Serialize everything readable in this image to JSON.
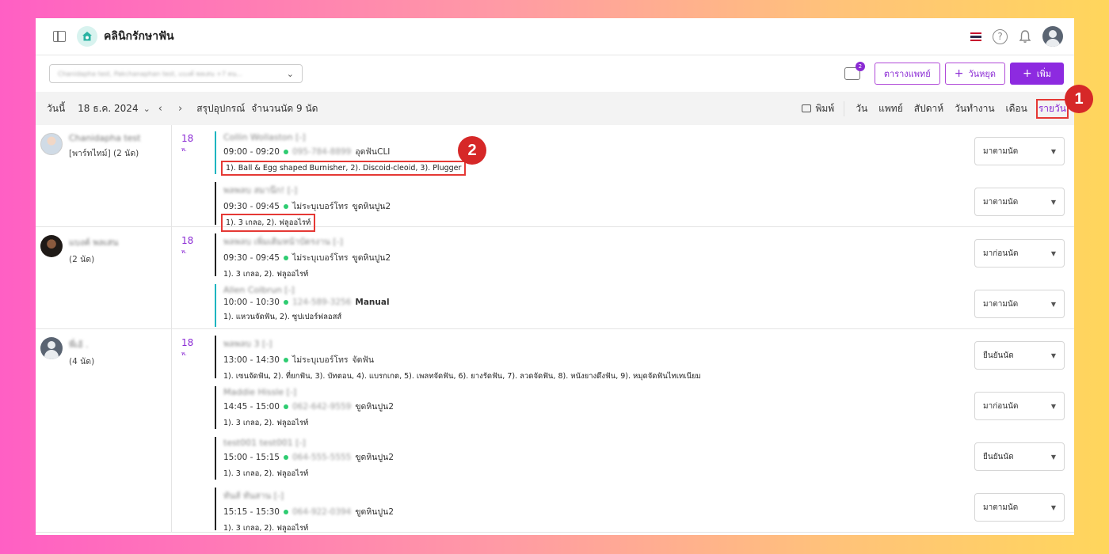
{
  "app": {
    "brand": "คลินิกรักษาฟัน"
  },
  "filter": {
    "doctor_select_value": "Chanidapha test, Pakchanaphan test, แบงค์ พลเสน +7 คน...",
    "inbox_badge": "2",
    "btn_schedule": "ตารางแพทย์",
    "btn_holiday": "วันหยุด",
    "btn_add": "เพิ่ม"
  },
  "datebar": {
    "today": "วันนี้",
    "date": "18 ธ.ค. 2024",
    "prev": "‹",
    "next": "›",
    "summary_equipment": "สรุปอุปกรณ์",
    "summary_count": "จำนวนนัด 9 นัด",
    "print": "พิมพ์",
    "tabs": [
      "วัน",
      "แพทย์",
      "สัปดาห์",
      "วันทำงาน",
      "เดือน",
      "รายวัน"
    ]
  },
  "steps": [
    "1",
    "2"
  ],
  "groups": [
    {
      "doctor_name": "Chanidapha test",
      "doctor_sub": "[พาร์ทไทม์] (2 นัด)",
      "day": "18",
      "day_sub": "พ.",
      "appointments": [
        {
          "patient": "Collin Wollaston [-]",
          "time": "09:00 - 09:20",
          "phone": "095-784-8899",
          "note": "อุดฟันCLI",
          "items": "1). Ball & Egg shaped Burnisher, 2). Discoid-cleoid, 3). Plugger",
          "status": "มาตามนัด",
          "bar": "teal"
        },
        {
          "patient": "พลพลบ สมาน๊ก! [-]",
          "time": "09:30 - 09:45",
          "phone": "ไม่ระบุเบอร์โทร",
          "note": "ขูดหินปูน2",
          "items": "1). 3 เกลอ, 2). ฟลูออไรท์",
          "status": "มาตามนัด",
          "bar": "dark"
        }
      ]
    },
    {
      "doctor_name": "แบงค์ พลเสน",
      "doctor_sub": "(2 นัด)",
      "day": "18",
      "day_sub": "พ.",
      "appointments": [
        {
          "patient": "พลพลบ เพิ่มเติมหน้าบัตรงาน [-]",
          "time": "09:30 - 09:45",
          "phone": "ไม่ระบุเบอร์โทร",
          "note": "ขูดหินปูน2",
          "items": "1). 3 เกลอ, 2). ฟลูออไรท์",
          "status": "มาก่อนนัด",
          "bar": "dark"
        },
        {
          "patient": "Allen Colbrun [-]",
          "time": "10:00 - 10:30",
          "phone": "124-589-3256",
          "note": "Manual",
          "items": "1). แหวนจัดฟัน, 2). ซูปเปอร์ฟลอสส์",
          "status": "มาตามนัด",
          "bar": "teal"
        }
      ]
    },
    {
      "doctor_name": "พี่เอ้ .",
      "doctor_sub": "(4 นัด)",
      "day": "18",
      "day_sub": "พ.",
      "appointments": [
        {
          "patient": "พลพลบ 3 [-]",
          "time": "13:00 - 14:30",
          "phone": "ไม่ระบุเบอร์โทร",
          "note": "จัดฟัน",
          "items": "1). เซนจัดฟัน, 2). ที่ยกฟัน, 3). บัทตอน, 4). แบรกเกต, 5). เพลทจัดฟัน, 6). ยางรัดฟัน, 7). ลวดจัดฟัน, 8). หนังยางดึงฟัน, 9). หมุดจัดฟันไทเทเนียม",
          "status": "ยืนยันนัด",
          "bar": "dark"
        },
        {
          "patient": "Maddie Hissle [-]",
          "time": "14:45 - 15:00",
          "phone": "062-642-9559",
          "note": "ขูดหินปูน2",
          "items": "1). 3 เกลอ, 2). ฟลูออไรท์",
          "status": "มาก่อนนัด",
          "bar": "dark"
        },
        {
          "patient": "test001 test001 [-]",
          "time": "15:00 - 15:15",
          "phone": "064-555-5555",
          "note": "ขูดหินปูน2",
          "items": "1). 3 เกลอ, 2). ฟลูออไรท์",
          "status": "ยืนยันนัด",
          "bar": "dark"
        },
        {
          "patient": "ทันส์ ทันสาน [-]",
          "time": "15:15 - 15:30",
          "phone": "064-922-0394",
          "note": "ขูดหินปูน2",
          "items": "1). 3 เกลอ, 2). ฟลูออไรท์",
          "status": "มาตามนัด",
          "bar": "dark"
        }
      ]
    }
  ]
}
